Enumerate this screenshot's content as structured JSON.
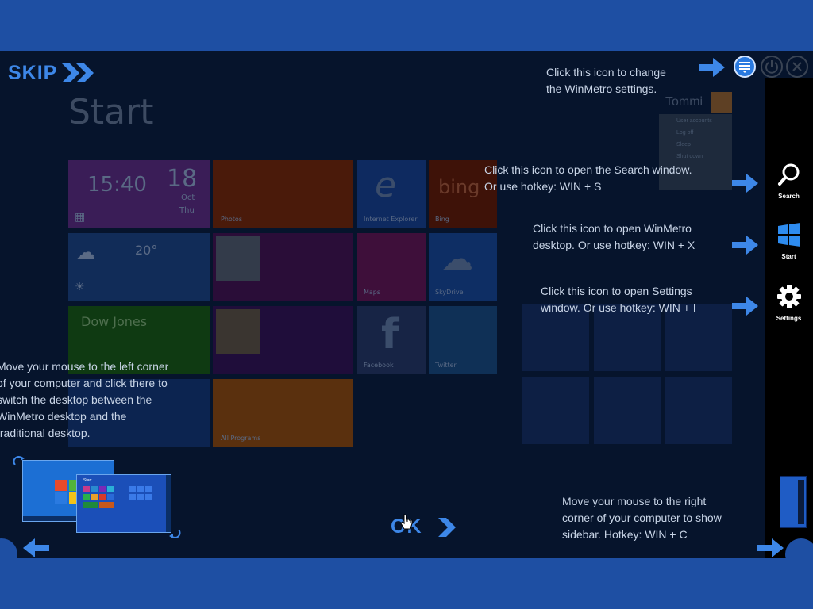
{
  "skip": {
    "label": "SKIP"
  },
  "start_screen": {
    "title": "Start",
    "user_name": "Tommi",
    "user_menu": [
      "User accounts",
      "Log off",
      "Sleep",
      "Shut down"
    ],
    "clock_time": "15:40",
    "clock_day": "18",
    "clock_month": "Oct",
    "clock_weekday": "Thu",
    "weather_temp": "20°",
    "stocks_title": "Dow Jones",
    "bing_label": "bing",
    "tile_labels": [
      "Photos",
      "Internet Explorer",
      "Bing",
      "Maps",
      "SkyDrive",
      "Facebook",
      "Twitter",
      "All Programs"
    ]
  },
  "sidebar": {
    "search_label": "Search",
    "start_label": "Start",
    "settings_label": "Settings"
  },
  "tips": {
    "settings_icon": "Click this icon to change\nthe WinMetro settings.",
    "search": "Click this icon to open the Search window.\nOr use hotkey: WIN + S",
    "start": "Click this icon to open WinMetro\ndesktop. Or use hotkey: WIN + X",
    "settings": "Click this icon to open Settings\nwindow. Or use hotkey: WIN + I",
    "left_corner": "Move your mouse to the left corner\nof your computer and click there to\nswitch the desktop between the\nWinMetro desktop and the\ntraditional desktop.",
    "right_corner": "Move your mouse to the right\ncorner of your computer to show\nsidebar. Hotkey: WIN + C"
  },
  "ok": {
    "label": "OK"
  },
  "preview": {
    "start_label": "Start"
  },
  "colors": {
    "accent": "#3d87e8",
    "background_band": "#1e4fa3",
    "stage": "#06142c",
    "tip_text": "#c8d4e6"
  },
  "icons": [
    "double-chevron-right-icon",
    "arrow-right-icon",
    "settings-menu-icon",
    "power-icon",
    "close-icon",
    "search-icon",
    "windows-logo-icon",
    "gear-icon",
    "arrow-left-icon",
    "chevron-right-icon",
    "mouse-cursor-icon"
  ]
}
